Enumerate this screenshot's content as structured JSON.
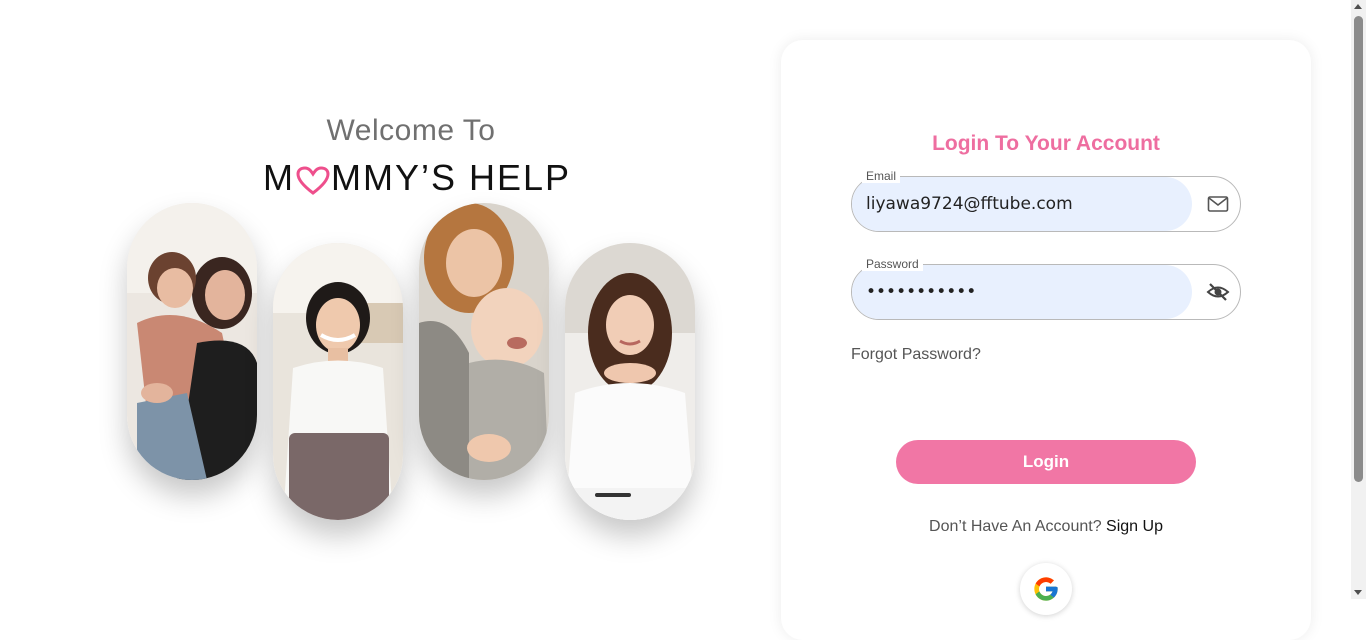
{
  "hero": {
    "welcome": "Welcome To",
    "brand_prefix": "M",
    "brand_suffix": "MMY’S HELP",
    "heart_color": "#ee4f8c",
    "photos": [
      {
        "name": "mother-hugging-son-photo"
      },
      {
        "name": "woman-with-laptop-photo"
      },
      {
        "name": "mother-holding-baby-photo"
      },
      {
        "name": "woman-in-white-shirt-photo"
      }
    ]
  },
  "login": {
    "title": "Login To Your Account",
    "email": {
      "label": "Email",
      "value": "liyawa9724@fftube.com",
      "icon": "mail-icon"
    },
    "password": {
      "label": "Password",
      "value": "•••••••••••",
      "icon": "eye-off-icon"
    },
    "forgot": "Forgot Password?",
    "button": "Login",
    "no_account": "Don’t Have An Account?",
    "signup": "Sign Up",
    "google_icon": "google-icon"
  },
  "colors": {
    "accent": "#f176a5",
    "title": "#ee6ea0",
    "autofill": "#e8f0fe"
  }
}
